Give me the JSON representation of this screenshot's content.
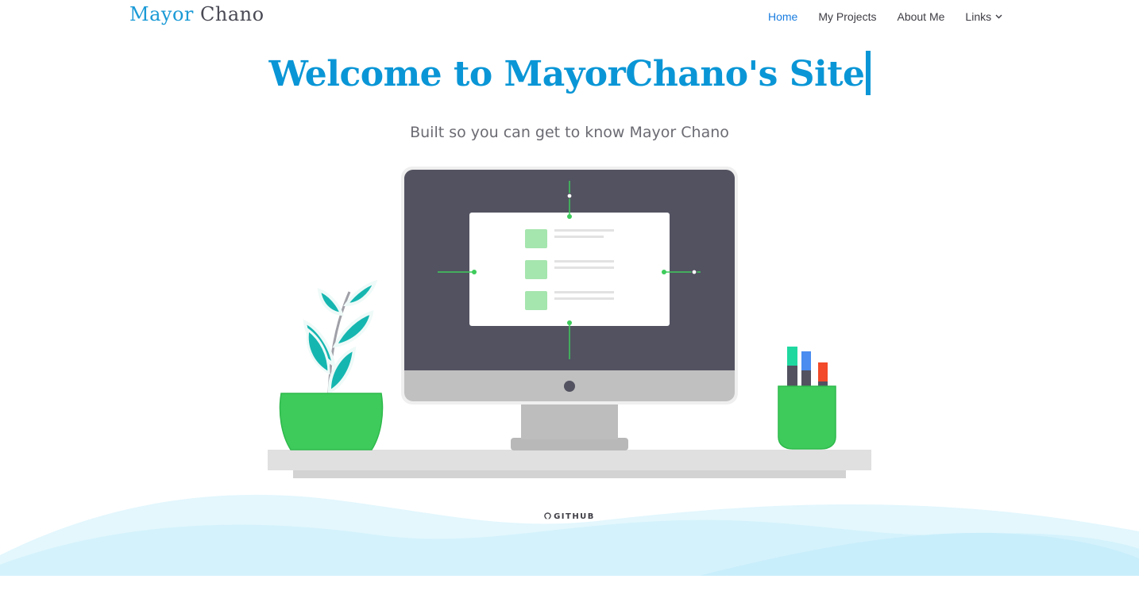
{
  "brand": {
    "first": "Mayor",
    "last": "Chano"
  },
  "nav": {
    "items": [
      {
        "label": "Home",
        "active": true
      },
      {
        "label": "My Projects"
      },
      {
        "label": "About Me"
      },
      {
        "label": "Links",
        "dropdown": true,
        "icon": "chevron-down-icon"
      }
    ]
  },
  "hero": {
    "title": "Welcome to MayorChano's Site",
    "subtitle": "Built so you can get to know Mayor Chano"
  },
  "footer": {
    "github_label": "GITHUB",
    "icon": "github-icon"
  },
  "colors": {
    "brand_blue": "#1a9ad6",
    "nav_active": "#1a7de0",
    "title_blue": "#0a96d6",
    "monitor_dark": "#525261",
    "plant_green": "#3ecb5b",
    "leaf_teal": "#16b6b0",
    "wave_light": "#d9f5fd"
  }
}
